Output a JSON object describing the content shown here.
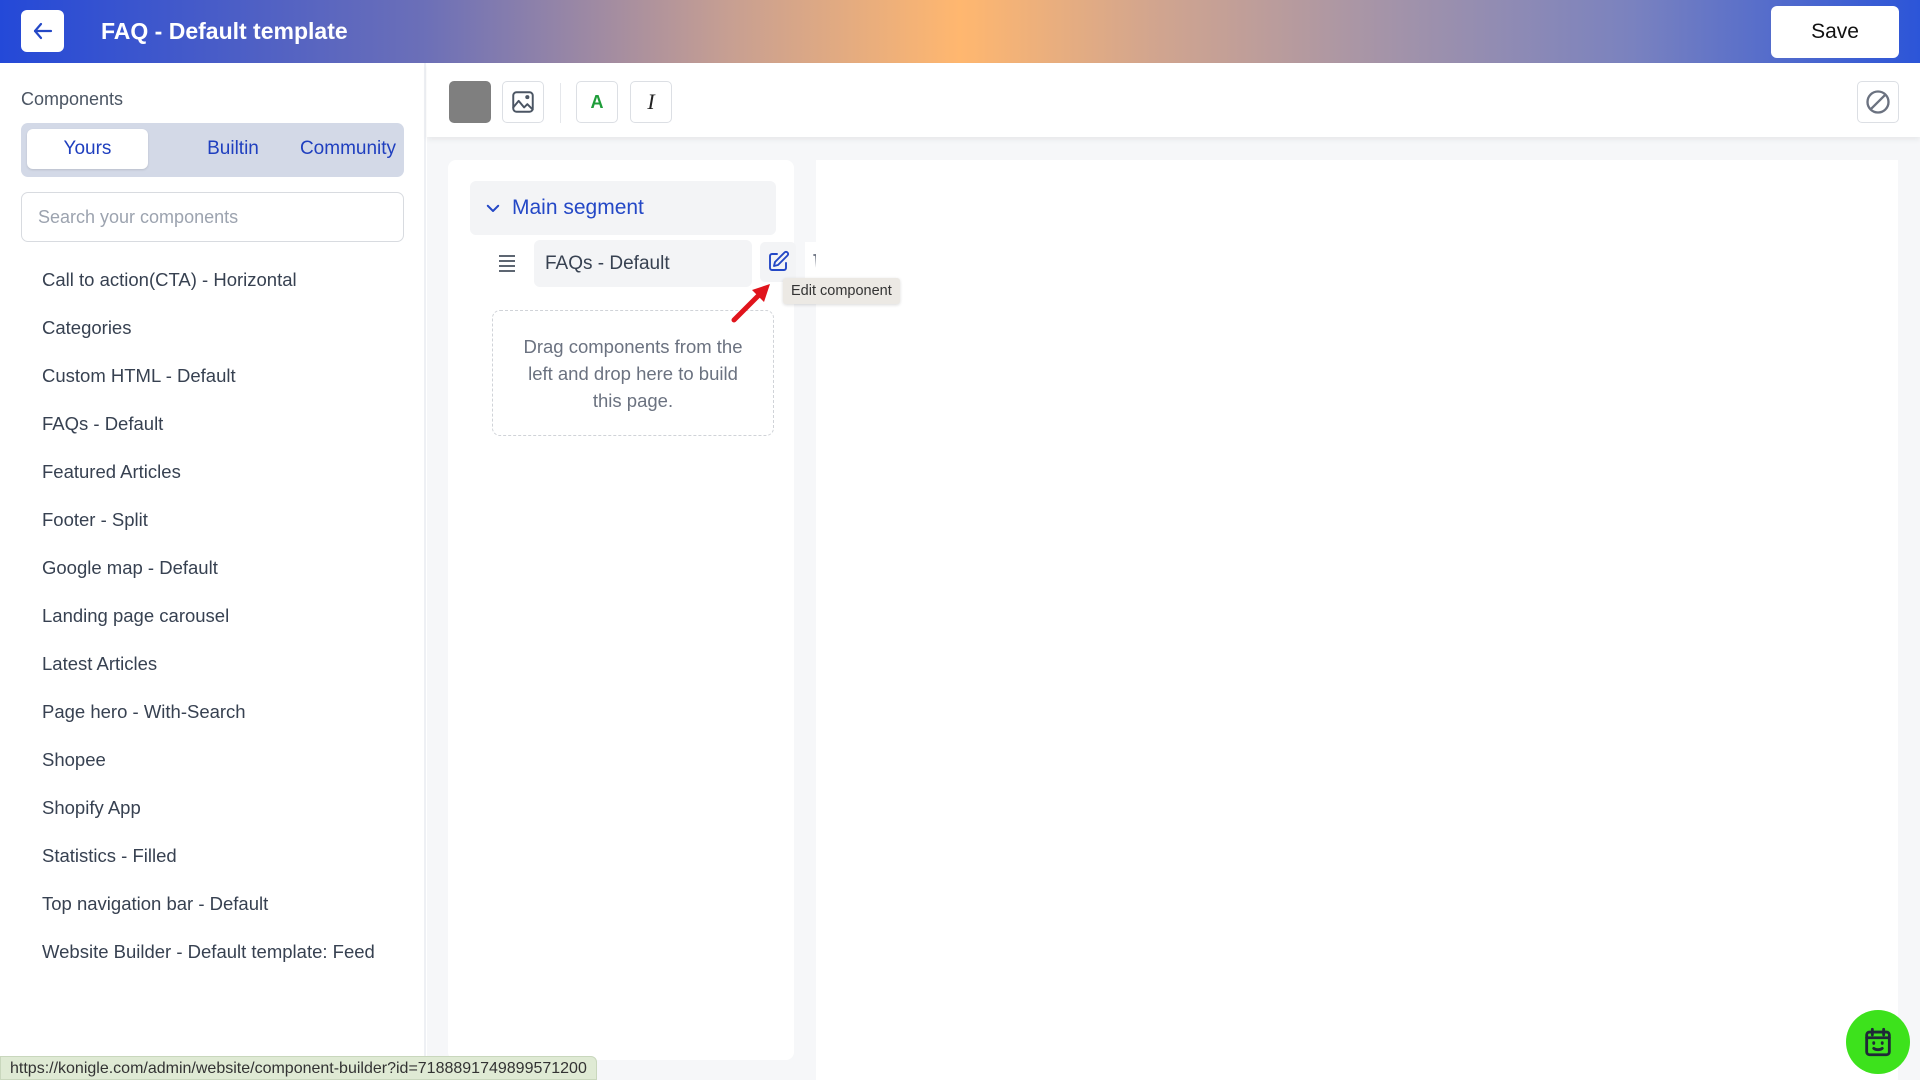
{
  "header": {
    "title": "FAQ - Default template",
    "back_icon": "arrow-left-icon",
    "save_label": "Save"
  },
  "sidebar": {
    "heading": "Components",
    "tabs": [
      {
        "label": "Yours",
        "active": true
      },
      {
        "label": "Builtin",
        "active": false
      },
      {
        "label": "Community",
        "active": false
      }
    ],
    "search": {
      "placeholder": "Search your components",
      "value": ""
    },
    "components": [
      "Call to action(CTA) - Horizontal",
      "Categories",
      "Custom HTML - Default",
      "FAQs - Default",
      "Featured Articles",
      "Footer - Split",
      "Google map - Default",
      "Landing page carousel",
      "Latest Articles",
      "Page hero - With-Search",
      "Shopee",
      "Shopify App",
      "Statistics - Filled",
      "Top navigation bar - Default",
      "Website Builder - Default template: Feed"
    ]
  },
  "toolbar": {
    "background_color_swatch": "#7f7f7f",
    "image_icon": "image-icon",
    "text_color_label": "A",
    "text_color": "#1f9d3a",
    "italic_label": "I",
    "disable_icon": "ban-icon"
  },
  "canvas": {
    "segment": {
      "title": "Main segment",
      "expanded": true,
      "components": [
        {
          "name": "FAQs - Default"
        }
      ]
    },
    "tooltip": "Edit component",
    "dropzone_text": "Drag components from the left and drop here to build this page."
  },
  "statusbar": {
    "url": "https://konigle.com/admin/website/component-builder?id=7188891749899571200"
  },
  "colors": {
    "accent": "#2448c6",
    "helper_button": "#3de21c",
    "annotation_arrow": "#e0141c"
  }
}
